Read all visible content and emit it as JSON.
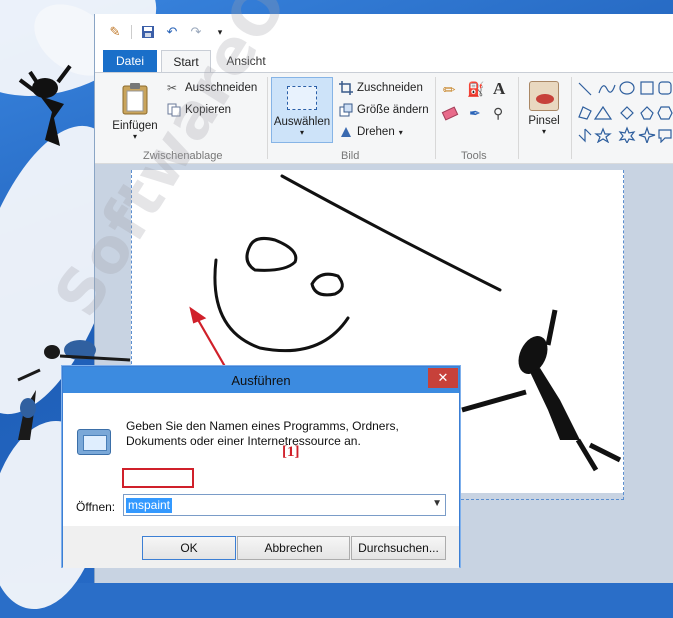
{
  "paint": {
    "tabs": {
      "file": "Datei",
      "start": "Start",
      "view": "Ansicht"
    },
    "clipboard": {
      "paste": "Einfügen",
      "cut": "Ausschneiden",
      "copy": "Kopieren",
      "group": "Zwischenablage"
    },
    "image": {
      "select": "Auswählen",
      "crop": "Zuschneiden",
      "resize": "Größe ändern",
      "rotate": "Drehen",
      "group": "Bild"
    },
    "tools": {
      "group": "Tools"
    },
    "brushes": {
      "label": "Pinsel"
    }
  },
  "run_dialog": {
    "title": "Ausführen",
    "close": "✕",
    "description": "Geben Sie den Namen eines Programms, Ordners, Dokuments oder einer Internetressource an.",
    "open_label": "Öffnen:",
    "input_value": "mspaint",
    "ok": "OK",
    "cancel": "Abbrechen",
    "browse": "Durchsuchen..."
  },
  "annotation": {
    "label": "[1]",
    "color": "#d0202a"
  },
  "watermark": "SoftwareOK.de",
  "colors": {
    "accent": "#1a6fc9",
    "titlebar": "#3c8be0",
    "close": "#c7413a"
  }
}
